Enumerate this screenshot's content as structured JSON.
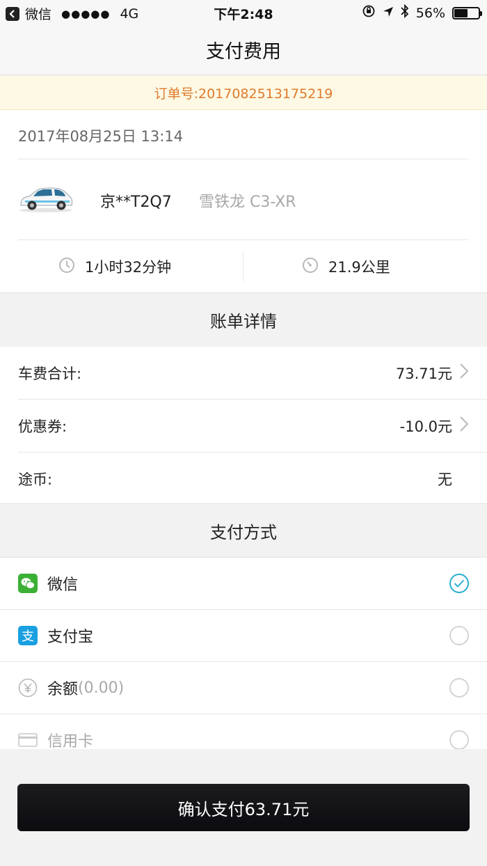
{
  "status_bar": {
    "back_app": "微信",
    "signal_dots": "●●●●●",
    "network": "4G",
    "time": "下午2:48",
    "battery": "56%",
    "battery_level": 0.56
  },
  "nav": {
    "title": "支付费用"
  },
  "order": {
    "label": "订单号:2017082513175219"
  },
  "trip": {
    "datetime": "2017年08月25日 13:14",
    "plate": "京**T2Q7",
    "model": "雪铁龙 C3-XR",
    "duration": "1小时32分钟",
    "distance": "21.9公里"
  },
  "bill": {
    "header": "账单详情",
    "items": [
      {
        "label": "车费合计:",
        "value": "73.71元",
        "has_arrow": true
      },
      {
        "label": "优惠券:",
        "value": "-10.0元",
        "has_arrow": true
      },
      {
        "label": "途币:",
        "value": "无",
        "has_arrow": false
      }
    ]
  },
  "payment": {
    "header": "支付方式",
    "methods": [
      {
        "label": "微信",
        "extra": "",
        "icon": "wechat-icon",
        "selected": true,
        "disabled": false
      },
      {
        "label": "支付宝",
        "extra": "",
        "icon": "alipay-icon",
        "selected": false,
        "disabled": false
      },
      {
        "label": "余额",
        "extra": "(0.00)",
        "icon": "yuan-icon",
        "selected": false,
        "disabled": false
      },
      {
        "label": "信用卡",
        "extra": "",
        "icon": "credit-card-icon",
        "selected": false,
        "disabled": true
      }
    ]
  },
  "confirm": {
    "label": "确认支付63.71元"
  },
  "colors": {
    "accent": "#2aaed1",
    "order_text": "#e07a2c",
    "banner_bg": "#fdf9e4",
    "wechat_green": "#3cb035",
    "alipay_blue": "#1a9fe0",
    "button_bg": "#111116"
  }
}
